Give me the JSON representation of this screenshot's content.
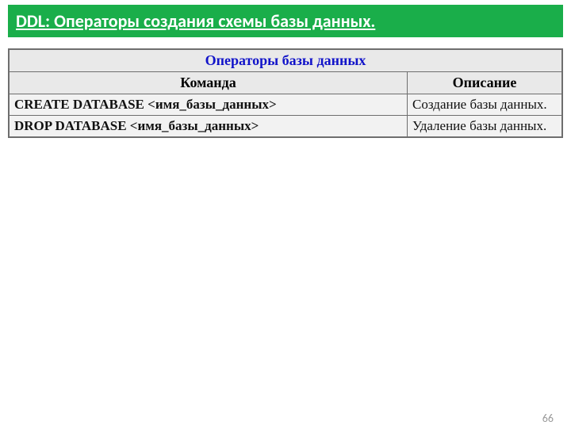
{
  "header": {
    "title": "DDL: Операторы создания схемы базы данных."
  },
  "table": {
    "caption": "Операторы базы данных",
    "columns": {
      "command": "Команда",
      "description": "Описание"
    },
    "rows": [
      {
        "command": "CREATE DATABASE <имя_базы_данных>",
        "description": "Создание базы данных."
      },
      {
        "command": "DROP DATABASE <имя_базы_данных>",
        "description": "Удаление базы данных."
      }
    ]
  },
  "page_number": "66"
}
